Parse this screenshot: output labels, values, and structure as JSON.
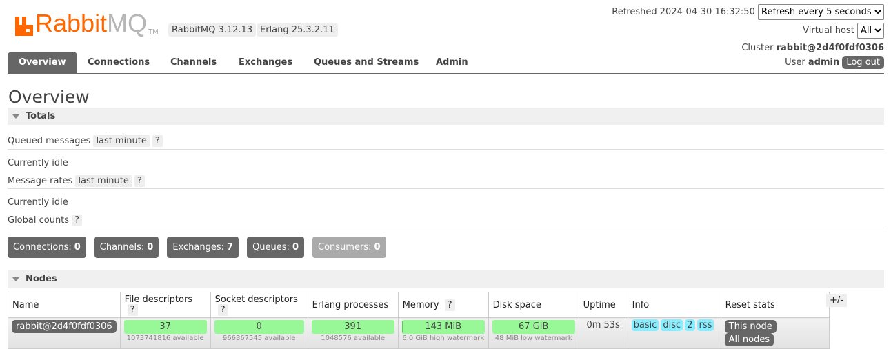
{
  "header": {
    "logo_text": "RabbitMQ",
    "logo_tm": "TM",
    "rabbitmq_version": "RabbitMQ 3.12.13",
    "erlang_version": "Erlang 25.3.2.11",
    "refreshed_label": "Refreshed",
    "refreshed_time": "2024-04-30 16:32:50",
    "refresh_select": "Refresh every 5 seconds",
    "vhost_label": "Virtual host",
    "vhost_select": "All",
    "cluster_label": "Cluster",
    "cluster_name": "rabbit@2d4f0fdf0306",
    "user_label": "User",
    "user_name": "admin",
    "logout": "Log out"
  },
  "tabs": [
    {
      "label": "Overview",
      "active": true
    },
    {
      "label": "Connections"
    },
    {
      "label": "Channels"
    },
    {
      "label": "Exchanges"
    },
    {
      "label": "Queues and Streams"
    },
    {
      "label": "Admin"
    }
  ],
  "page_title": "Overview",
  "totals": {
    "title": "Totals",
    "queued_label": "Queued messages",
    "queued_range": "last minute",
    "help": "?",
    "idle1": "Currently idle",
    "rates_label": "Message rates",
    "rates_range": "last minute",
    "idle2": "Currently idle",
    "global_label": "Global counts"
  },
  "counts": [
    {
      "label": "Connections:",
      "value": "0"
    },
    {
      "label": "Channels:",
      "value": "0"
    },
    {
      "label": "Exchanges:",
      "value": "7"
    },
    {
      "label": "Queues:",
      "value": "0"
    },
    {
      "label": "Consumers:",
      "value": "0"
    }
  ],
  "nodes": {
    "title": "Nodes",
    "columns": [
      "Name",
      "File descriptors",
      "Socket descriptors",
      "Erlang processes",
      "Memory",
      "Disk space",
      "Uptime",
      "Info",
      "Reset stats"
    ],
    "plus_minus": "+/-",
    "row": {
      "name": "rabbit@2d4f0fdf0306",
      "fd": "37",
      "fd_sub": "1073741816 available",
      "sd": "0",
      "sd_sub": "966367545 available",
      "ep": "391",
      "ep_sub": "1048576 available",
      "mem": "143 MiB",
      "mem_sub": "6.0 GiB high watermark",
      "mem_fraction": 0.023,
      "disk": "67 GiB",
      "disk_sub": "48 MiB low watermark",
      "uptime": "0m 53s",
      "info": [
        "basic",
        "disc",
        "2",
        "rss"
      ],
      "reset_this": "This node",
      "reset_all": "All nodes"
    }
  }
}
